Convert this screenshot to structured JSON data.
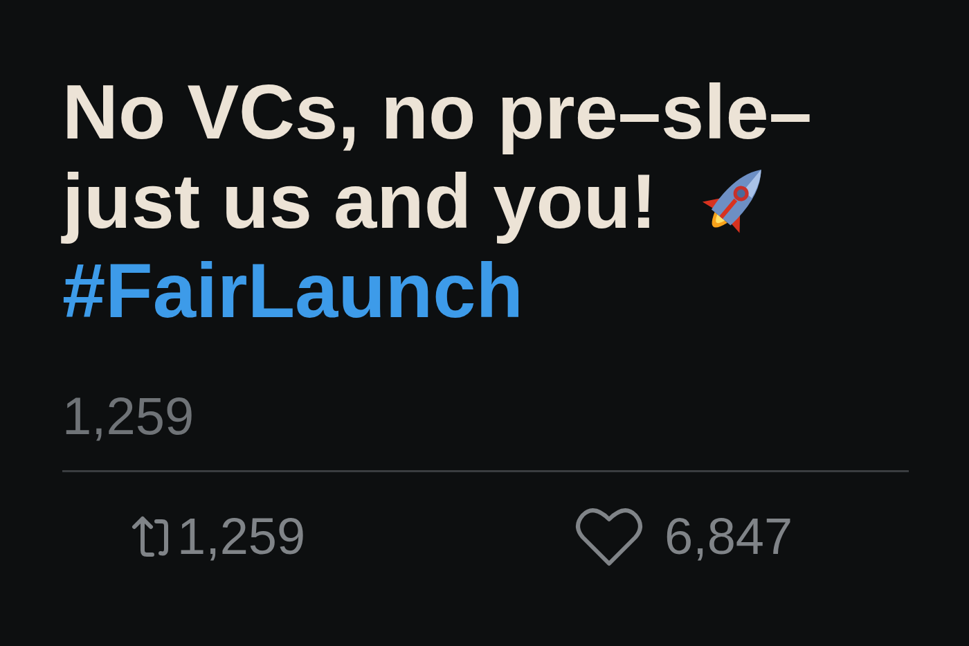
{
  "post": {
    "text_lines": [
      "No VCs, no pre–sle–",
      "just us and you!"
    ],
    "hashtag": "#FairLaunch",
    "count": "1,259",
    "actions": [
      {
        "kind": "repost",
        "count": "1,259"
      },
      {
        "kind": "like",
        "count": "6,847"
      }
    ]
  }
}
